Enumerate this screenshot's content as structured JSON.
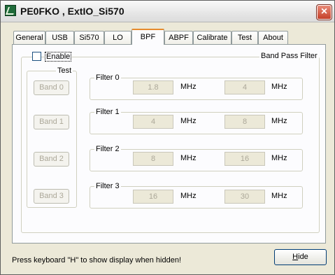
{
  "window": {
    "title": "PE0FKO , ExtIO_Si570",
    "close_label": "×"
  },
  "tabs": [
    {
      "label": "General"
    },
    {
      "label": "USB"
    },
    {
      "label": "Si570"
    },
    {
      "label": "LO"
    },
    {
      "label": "BPF"
    },
    {
      "label": "ABPF"
    },
    {
      "label": "Calibrate"
    },
    {
      "label": "Test"
    },
    {
      "label": "About"
    }
  ],
  "active_tab": "BPF",
  "bpf": {
    "enable_label": "Enable",
    "enable_checked": false,
    "group_title": "Band Pass Filter",
    "test_group_title": "Test",
    "test_buttons": [
      "Band 0",
      "Band 1",
      "Band 2",
      "Band 3"
    ],
    "filters": [
      {
        "title": "Filter 0",
        "low": "1.8",
        "low_unit": "MHz",
        "high": "4",
        "high_unit": "MHz"
      },
      {
        "title": "Filter 1",
        "low": "4",
        "low_unit": "MHz",
        "high": "8",
        "high_unit": "MHz"
      },
      {
        "title": "Filter 2",
        "low": "8",
        "low_unit": "MHz",
        "high": "16",
        "high_unit": "MHz"
      },
      {
        "title": "Filter 3",
        "low": "16",
        "low_unit": "MHz",
        "high": "30",
        "high_unit": "MHz"
      }
    ]
  },
  "status_text": "Press keyboard \"H\" to show display when hidden!",
  "hide_button": {
    "underlined": "H",
    "rest": "ide"
  }
}
